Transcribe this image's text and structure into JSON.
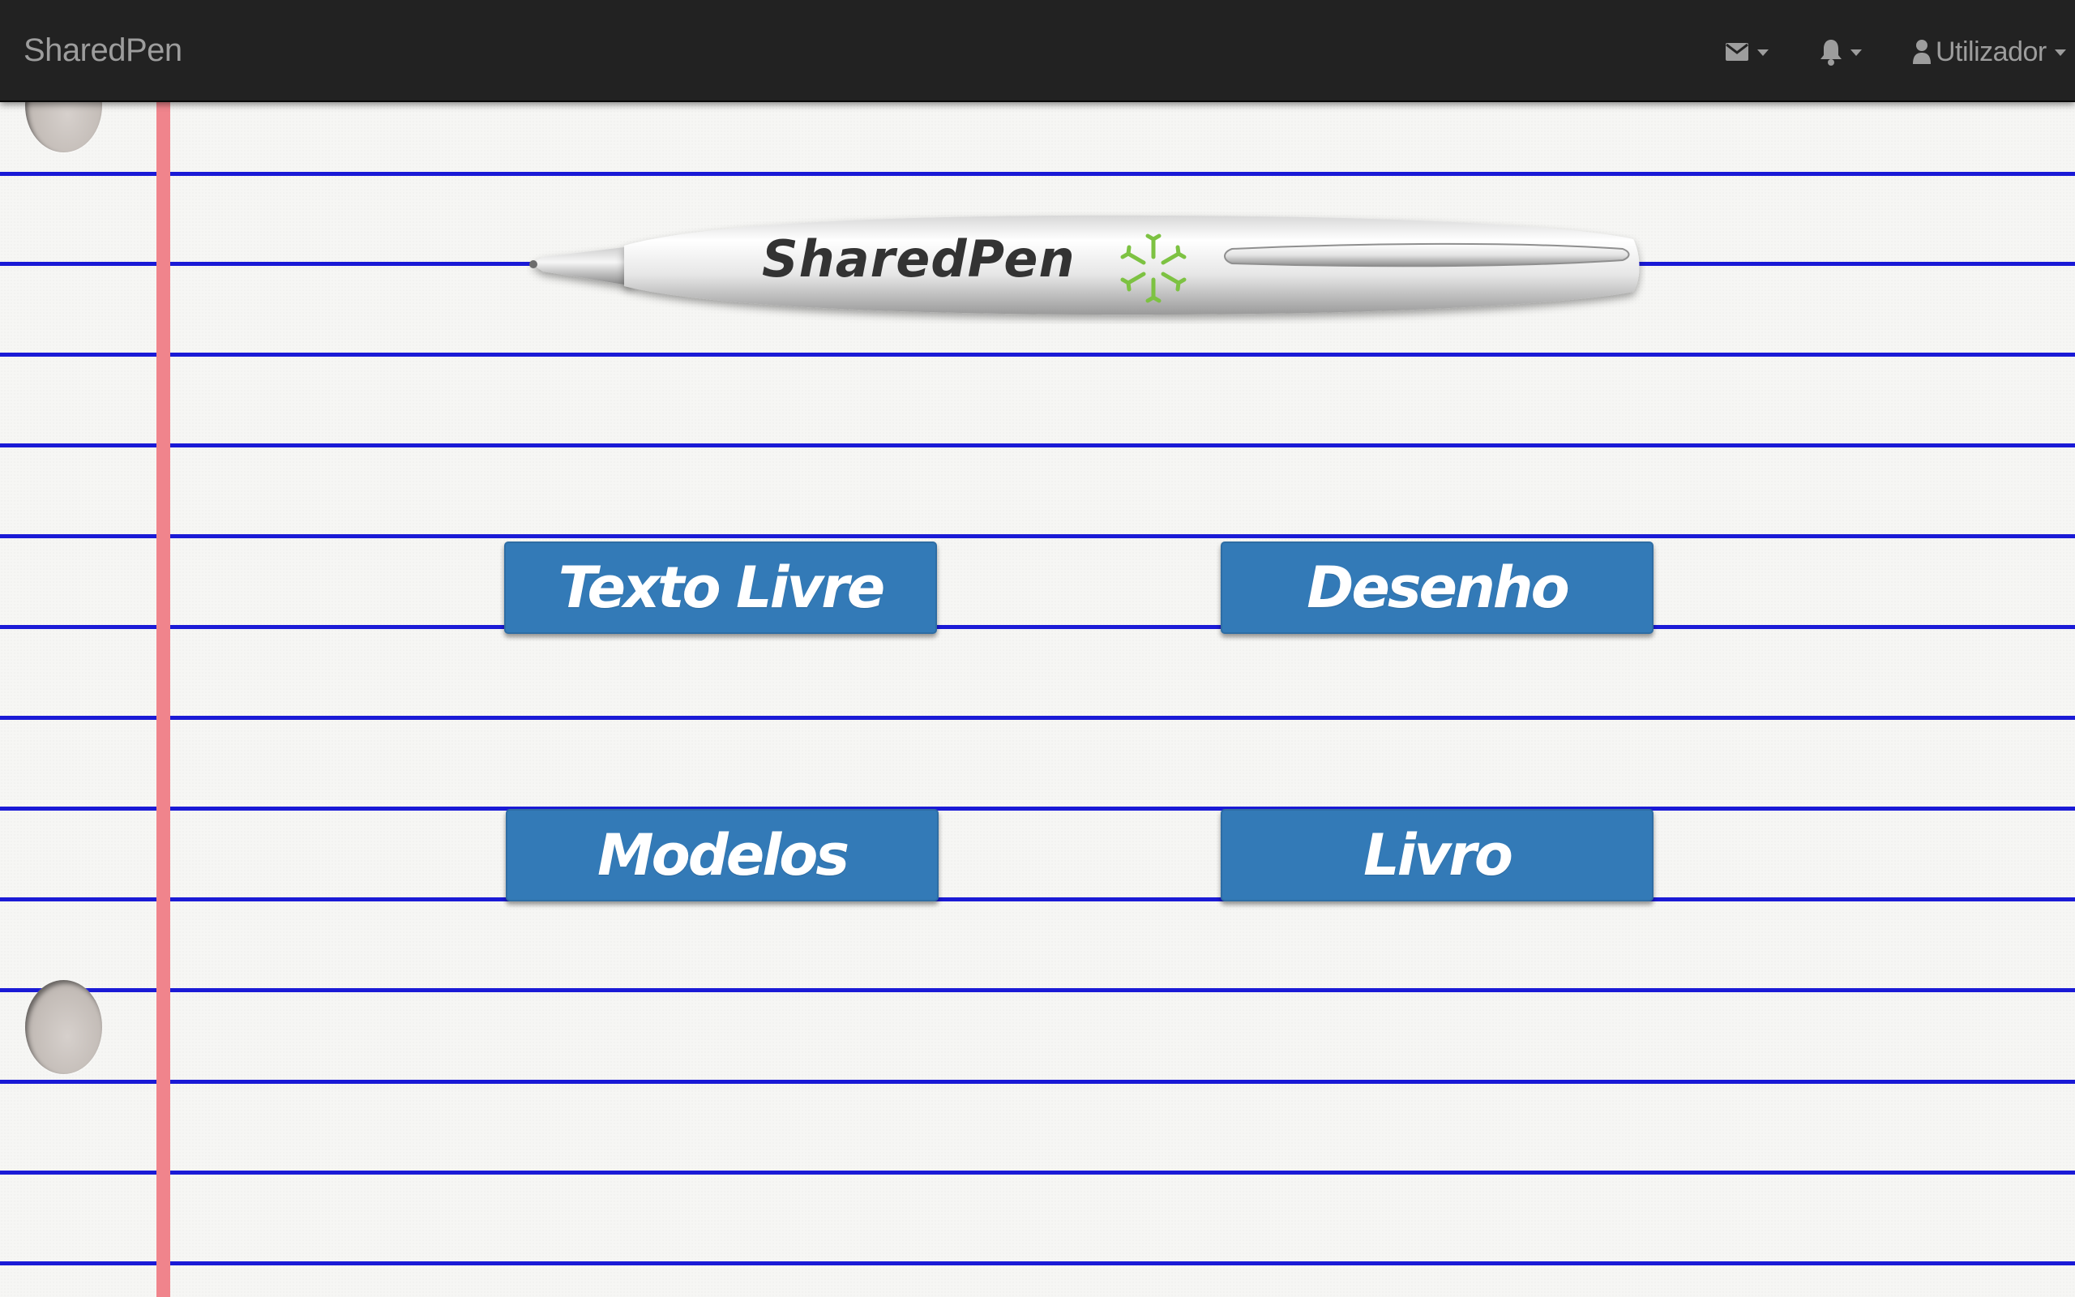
{
  "navbar": {
    "brand": "SharedPen",
    "background_color": "#222222",
    "text_color": "#9d9d9d",
    "items": [
      {
        "icon": "envelope-icon",
        "has_dropdown": true
      },
      {
        "icon": "bell-icon",
        "has_dropdown": true
      },
      {
        "icon": "user-icon",
        "label": "Utilizador",
        "has_dropdown": true
      }
    ]
  },
  "logo": {
    "text": "SharedPen",
    "symbol_color": "#7dc242"
  },
  "actions": {
    "texto_livre": "Texto Livre",
    "desenho": "Desenho",
    "modelos": "Modelos",
    "livro": "Livro"
  },
  "theme": {
    "button_color": "#337ab7",
    "rule_line_color": "#1a1ad6",
    "margin_line_color": "#f0848c",
    "paper_color": "#f6f6f4"
  }
}
